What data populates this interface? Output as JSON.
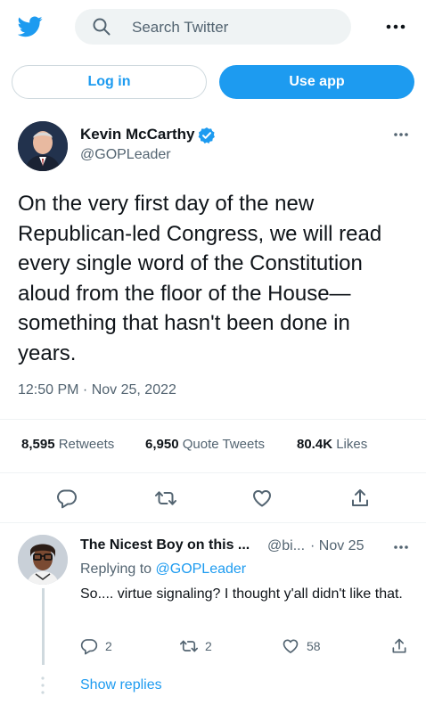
{
  "header": {
    "search_placeholder": "Search Twitter"
  },
  "auth": {
    "login_label": "Log in",
    "use_app_label": "Use app"
  },
  "tweet": {
    "author_name": "Kevin McCarthy",
    "author_handle": "@GOPLeader",
    "text": "On the very first day of the new Republican-led Congress, we will read every single word of the Constitution aloud from the floor of the House—something that hasn't been done in years.",
    "timestamp": "12:50 PM · Nov 25, 2022",
    "stats": {
      "retweets_count": "8,595",
      "retweets_label": "Retweets",
      "quotes_count": "6,950",
      "quotes_label": "Quote Tweets",
      "likes_count": "80.4K",
      "likes_label": "Likes"
    }
  },
  "reply": {
    "author_name": "The Nicest Boy on this ...",
    "author_handle": "@bi...",
    "date": "· Nov 25",
    "replying_prefix": "Replying to",
    "replying_to": "@GOPLeader",
    "text": "So.... virtue signaling?  I thought y'all didn't like that.",
    "reply_count": "2",
    "retweet_count": "2",
    "like_count": "58"
  },
  "show_replies_label": "Show replies",
  "colors": {
    "accent": "#1d9bf0",
    "text_primary": "#0f1419",
    "text_secondary": "#536471",
    "divider": "#eff3f4"
  },
  "icons": [
    "twitter-bird-icon",
    "search-icon",
    "more-icon",
    "verified-badge-icon",
    "reply-icon",
    "retweet-icon",
    "like-icon",
    "share-icon"
  ]
}
